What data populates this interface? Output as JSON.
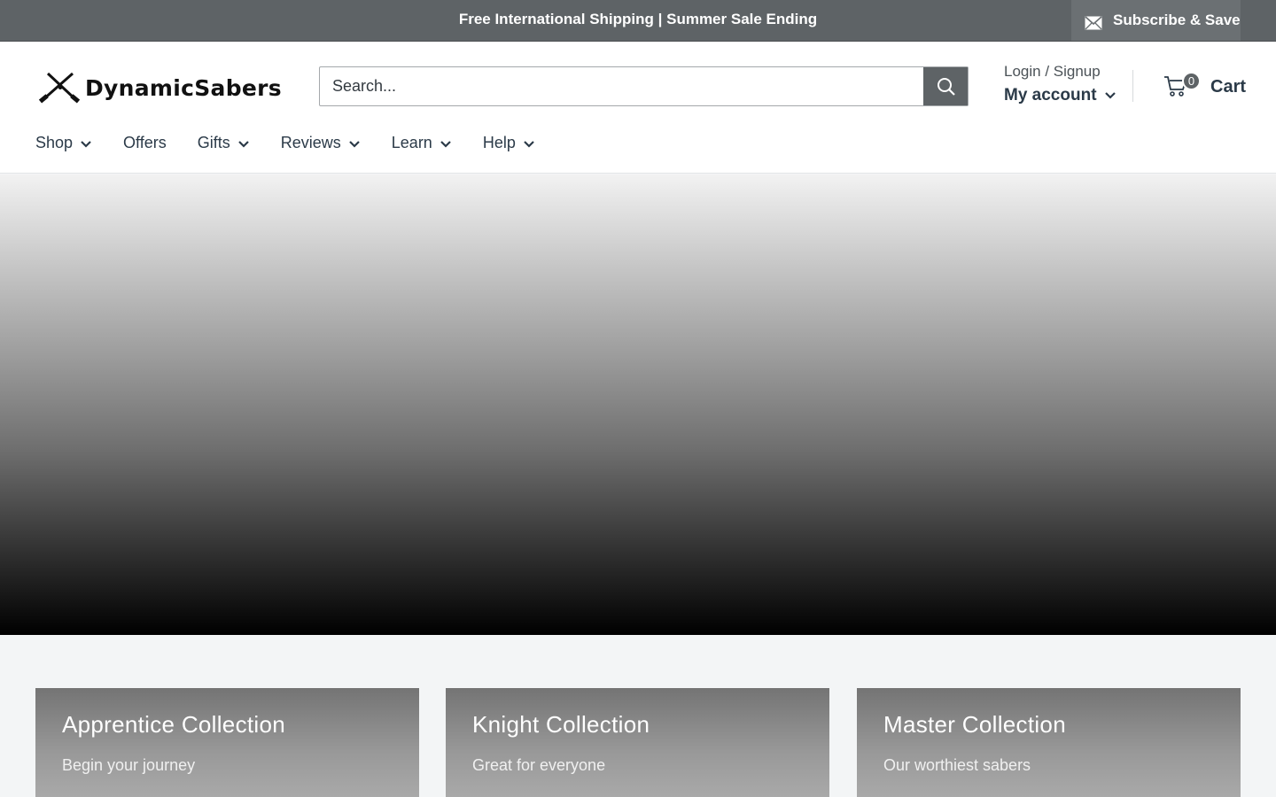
{
  "announcement": {
    "text": "Free International Shipping | Summer Sale Ending",
    "subscribe_label": "Subscribe & Save",
    "subscribe_icon": "mail-icon"
  },
  "header": {
    "logo_text": "DynamicSabers",
    "logo_icon": "crossed-sabers-icon",
    "search": {
      "placeholder": "Search...",
      "button_icon": "search-icon"
    },
    "account": {
      "login_label": "Login / Signup",
      "my_account_label": "My account"
    },
    "cart": {
      "count": "0",
      "label": "Cart",
      "icon": "cart-icon"
    }
  },
  "nav": {
    "items": [
      {
        "label": "Shop",
        "has_dropdown": true
      },
      {
        "label": "Offers",
        "has_dropdown": false
      },
      {
        "label": "Gifts",
        "has_dropdown": true
      },
      {
        "label": "Reviews",
        "has_dropdown": true
      },
      {
        "label": "Learn",
        "has_dropdown": true
      },
      {
        "label": "Help",
        "has_dropdown": true
      }
    ]
  },
  "collections": [
    {
      "title": "Apprentice Collection",
      "subtitle": "Begin your journey"
    },
    {
      "title": "Knight Collection",
      "subtitle": "Great for everyone"
    },
    {
      "title": "Master Collection",
      "subtitle": "Our worthiest sabers"
    }
  ],
  "colors": {
    "announcement_bg": "#5e6366",
    "accent": "#5e6366",
    "text": "#2b3a48",
    "page_bg": "#f3f5f6"
  }
}
